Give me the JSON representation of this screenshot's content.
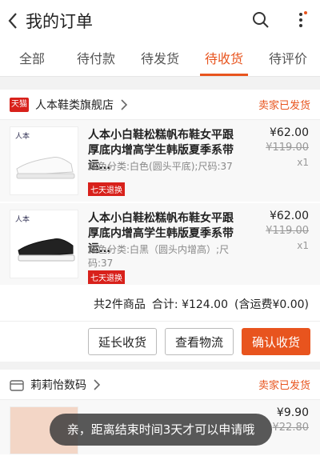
{
  "header": {
    "title": "我的订单"
  },
  "tabs": [
    "全部",
    "待付款",
    "待发货",
    "待收货",
    "待评价"
  ],
  "activeTab": "待收货",
  "orders": [
    {
      "shop": "人本鞋类旗舰店",
      "shopLogo": "天猫",
      "status": "卖家已发货",
      "items": [
        {
          "title": "人本小白鞋松糕帆布鞋女平跟厚底内增高学生韩版夏季系带运…",
          "spec": "颜色分类:白色(圆头平底);尺码:37",
          "badge": "七天退换",
          "price": "¥62.00",
          "oldPrice": "¥119.00",
          "qty": "x1",
          "brand": "人本"
        },
        {
          "title": "人本小白鞋松糕帆布鞋女平跟厚底内增高学生韩版夏季系带运…",
          "spec": "颜色分类:白黑（圆头内增高）;尺码:37",
          "badge": "七天退换",
          "price": "¥62.00",
          "oldPrice": "¥119.00",
          "qty": "x1",
          "brand": "人本"
        }
      ],
      "summary": {
        "count": "共2件商品",
        "total": "合计: ¥124.00",
        "shipping": "(含运费¥0.00)"
      },
      "actions": [
        "延长收货",
        "查看物流",
        "确认收货"
      ]
    },
    {
      "shop": "莉莉怡数码",
      "status": "卖家已发货",
      "items": [
        {
          "price": "¥9.90",
          "oldPrice": "¥22.80"
        }
      ]
    }
  ],
  "toast": "亲，距离结束时间3天才可以申请哦",
  "colors": {
    "accent": "#e8541e",
    "tmall": "#d8211b"
  }
}
